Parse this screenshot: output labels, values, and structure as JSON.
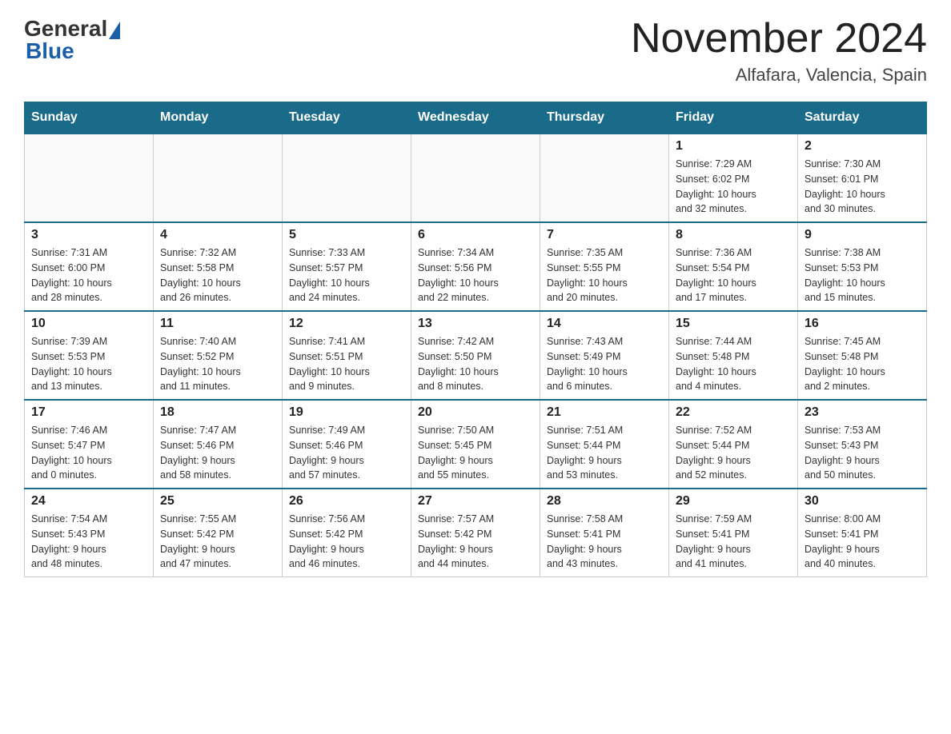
{
  "header": {
    "logo_general": "General",
    "logo_blue": "Blue",
    "title": "November 2024",
    "subtitle": "Alfafara, Valencia, Spain"
  },
  "days": [
    "Sunday",
    "Monday",
    "Tuesday",
    "Wednesday",
    "Thursday",
    "Friday",
    "Saturday"
  ],
  "weeks": [
    [
      {
        "day": "",
        "info": ""
      },
      {
        "day": "",
        "info": ""
      },
      {
        "day": "",
        "info": ""
      },
      {
        "day": "",
        "info": ""
      },
      {
        "day": "",
        "info": ""
      },
      {
        "day": "1",
        "info": "Sunrise: 7:29 AM\nSunset: 6:02 PM\nDaylight: 10 hours\nand 32 minutes."
      },
      {
        "day": "2",
        "info": "Sunrise: 7:30 AM\nSunset: 6:01 PM\nDaylight: 10 hours\nand 30 minutes."
      }
    ],
    [
      {
        "day": "3",
        "info": "Sunrise: 7:31 AM\nSunset: 6:00 PM\nDaylight: 10 hours\nand 28 minutes."
      },
      {
        "day": "4",
        "info": "Sunrise: 7:32 AM\nSunset: 5:58 PM\nDaylight: 10 hours\nand 26 minutes."
      },
      {
        "day": "5",
        "info": "Sunrise: 7:33 AM\nSunset: 5:57 PM\nDaylight: 10 hours\nand 24 minutes."
      },
      {
        "day": "6",
        "info": "Sunrise: 7:34 AM\nSunset: 5:56 PM\nDaylight: 10 hours\nand 22 minutes."
      },
      {
        "day": "7",
        "info": "Sunrise: 7:35 AM\nSunset: 5:55 PM\nDaylight: 10 hours\nand 20 minutes."
      },
      {
        "day": "8",
        "info": "Sunrise: 7:36 AM\nSunset: 5:54 PM\nDaylight: 10 hours\nand 17 minutes."
      },
      {
        "day": "9",
        "info": "Sunrise: 7:38 AM\nSunset: 5:53 PM\nDaylight: 10 hours\nand 15 minutes."
      }
    ],
    [
      {
        "day": "10",
        "info": "Sunrise: 7:39 AM\nSunset: 5:53 PM\nDaylight: 10 hours\nand 13 minutes."
      },
      {
        "day": "11",
        "info": "Sunrise: 7:40 AM\nSunset: 5:52 PM\nDaylight: 10 hours\nand 11 minutes."
      },
      {
        "day": "12",
        "info": "Sunrise: 7:41 AM\nSunset: 5:51 PM\nDaylight: 10 hours\nand 9 minutes."
      },
      {
        "day": "13",
        "info": "Sunrise: 7:42 AM\nSunset: 5:50 PM\nDaylight: 10 hours\nand 8 minutes."
      },
      {
        "day": "14",
        "info": "Sunrise: 7:43 AM\nSunset: 5:49 PM\nDaylight: 10 hours\nand 6 minutes."
      },
      {
        "day": "15",
        "info": "Sunrise: 7:44 AM\nSunset: 5:48 PM\nDaylight: 10 hours\nand 4 minutes."
      },
      {
        "day": "16",
        "info": "Sunrise: 7:45 AM\nSunset: 5:48 PM\nDaylight: 10 hours\nand 2 minutes."
      }
    ],
    [
      {
        "day": "17",
        "info": "Sunrise: 7:46 AM\nSunset: 5:47 PM\nDaylight: 10 hours\nand 0 minutes."
      },
      {
        "day": "18",
        "info": "Sunrise: 7:47 AM\nSunset: 5:46 PM\nDaylight: 9 hours\nand 58 minutes."
      },
      {
        "day": "19",
        "info": "Sunrise: 7:49 AM\nSunset: 5:46 PM\nDaylight: 9 hours\nand 57 minutes."
      },
      {
        "day": "20",
        "info": "Sunrise: 7:50 AM\nSunset: 5:45 PM\nDaylight: 9 hours\nand 55 minutes."
      },
      {
        "day": "21",
        "info": "Sunrise: 7:51 AM\nSunset: 5:44 PM\nDaylight: 9 hours\nand 53 minutes."
      },
      {
        "day": "22",
        "info": "Sunrise: 7:52 AM\nSunset: 5:44 PM\nDaylight: 9 hours\nand 52 minutes."
      },
      {
        "day": "23",
        "info": "Sunrise: 7:53 AM\nSunset: 5:43 PM\nDaylight: 9 hours\nand 50 minutes."
      }
    ],
    [
      {
        "day": "24",
        "info": "Sunrise: 7:54 AM\nSunset: 5:43 PM\nDaylight: 9 hours\nand 48 minutes."
      },
      {
        "day": "25",
        "info": "Sunrise: 7:55 AM\nSunset: 5:42 PM\nDaylight: 9 hours\nand 47 minutes."
      },
      {
        "day": "26",
        "info": "Sunrise: 7:56 AM\nSunset: 5:42 PM\nDaylight: 9 hours\nand 46 minutes."
      },
      {
        "day": "27",
        "info": "Sunrise: 7:57 AM\nSunset: 5:42 PM\nDaylight: 9 hours\nand 44 minutes."
      },
      {
        "day": "28",
        "info": "Sunrise: 7:58 AM\nSunset: 5:41 PM\nDaylight: 9 hours\nand 43 minutes."
      },
      {
        "day": "29",
        "info": "Sunrise: 7:59 AM\nSunset: 5:41 PM\nDaylight: 9 hours\nand 41 minutes."
      },
      {
        "day": "30",
        "info": "Sunrise: 8:00 AM\nSunset: 5:41 PM\nDaylight: 9 hours\nand 40 minutes."
      }
    ]
  ]
}
